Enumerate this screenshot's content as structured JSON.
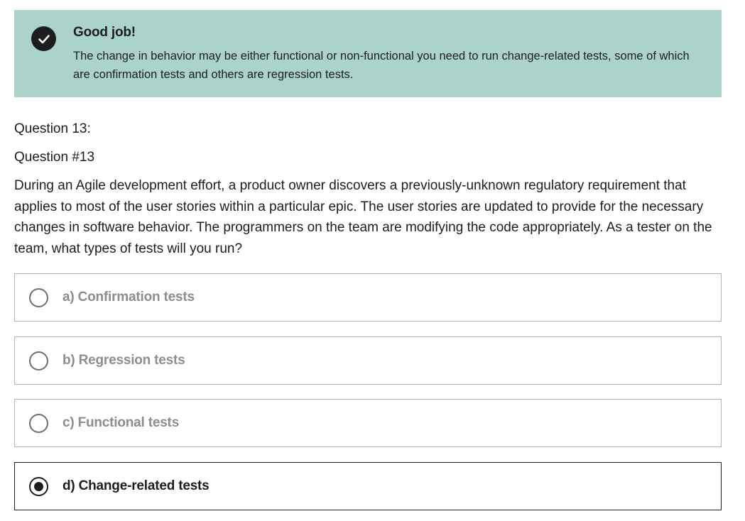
{
  "feedback": {
    "icon": "check-circle-icon",
    "title": "Good job!",
    "body": "The change in behavior may be either functional or non-functional you need to run change-related tests, some of which are confirmation tests and others are regression tests."
  },
  "question": {
    "number_label": "Question 13:",
    "title": "Question #13",
    "text": "During an Agile development effort, a product owner discovers a previously-unknown regulatory requirement that applies to most of the user stories within a particular epic. The user stories are updated to provide for the necessary changes in software behavior. The programmers on the team are modifying the code appropriately. As a tester on the team, what types of tests will you run?"
  },
  "options": [
    {
      "label": "a) Confirmation tests",
      "selected": false
    },
    {
      "label": "b) Regression tests",
      "selected": false
    },
    {
      "label": "c) Functional tests",
      "selected": false
    },
    {
      "label": "d) Change-related tests",
      "selected": true
    }
  ],
  "colors": {
    "success_background": "#acd2cc",
    "text": "#1c1d1f",
    "muted_option_text": "#8b8d90",
    "border": "#b0b2b5"
  }
}
